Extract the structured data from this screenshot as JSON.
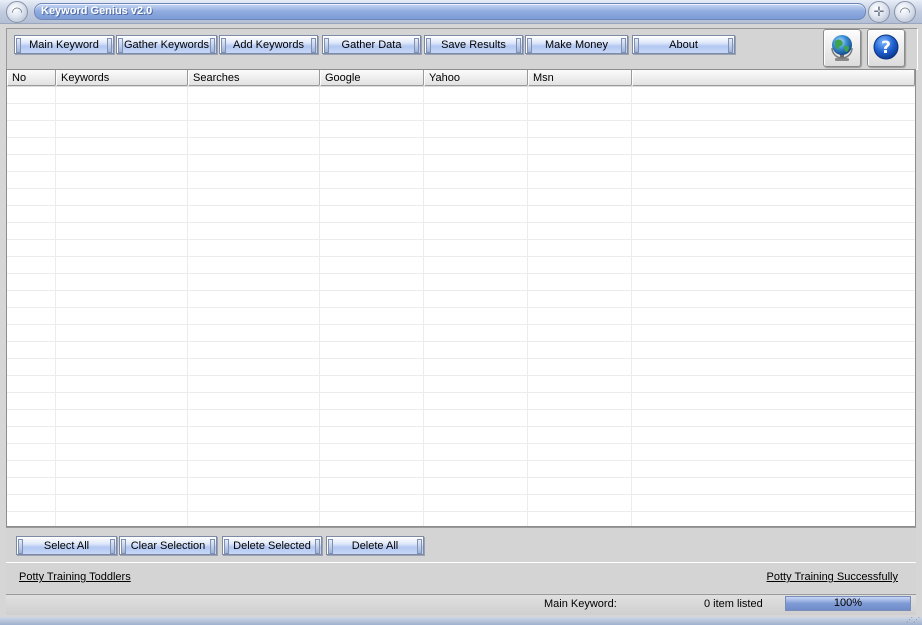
{
  "window": {
    "title": "Keyword Genius v2.0"
  },
  "toolbar": {
    "buttons": [
      {
        "label": "Main Keyword"
      },
      {
        "label": "Gather Keywords"
      },
      {
        "label": "Add Keywords"
      },
      {
        "label": "Gather Data"
      },
      {
        "label": "Save Results"
      },
      {
        "label": "Make Money"
      },
      {
        "label": "About"
      }
    ],
    "icons": [
      "globe-icon",
      "help-icon"
    ]
  },
  "table": {
    "columns": [
      "No",
      "Keywords",
      "Searches",
      "Google",
      "Yahoo",
      "Msn",
      ""
    ],
    "rows": []
  },
  "actions": {
    "select_all": "Select All",
    "clear_selection": "Clear Selection",
    "delete_selected": "Delete Selected",
    "delete_all": "Delete All"
  },
  "links": {
    "left": "Potty Training Toddlers",
    "right": "Potty Training Successfully"
  },
  "status": {
    "main_keyword_label": "Main Keyword:",
    "items_listed": "0 item listed",
    "progress_label": "100%",
    "progress_fraction": 1.0
  },
  "colors": {
    "accent": "#8fabde",
    "button_face": "#c6d6f7"
  }
}
